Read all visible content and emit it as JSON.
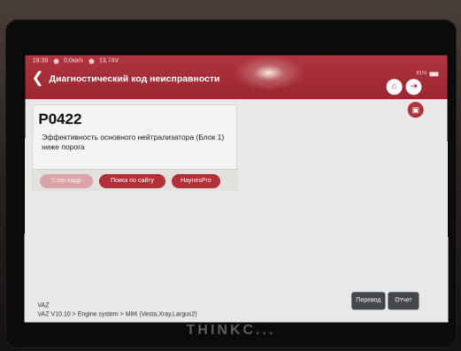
{
  "device": {
    "brand": "THINKC..."
  },
  "status": {
    "time": "19:39",
    "speed": "0,0кв/s",
    "voltage": "13,74V",
    "battery": "91%"
  },
  "header": {
    "title": "Диагностический код неисправности",
    "back_icon": "back-arrow-icon",
    "home_icon": "home-icon",
    "exit_icon": "exit-icon",
    "camera_icon": "camera-icon"
  },
  "dtc": {
    "code": "P0422",
    "description": "Эффективность основного нейтрализатора (Блок 1) ниже порога"
  },
  "actions": {
    "freeze_frame": "Стоп-кадр",
    "web_search": "Поиск по сайту",
    "haynes": "HaynesPro"
  },
  "footer": {
    "make": "VAZ",
    "path": "VAZ V10.10 > Engine system > М86 (Vesta,Xray,Largus2)",
    "translate": "Перевод",
    "report": "Отчет"
  },
  "colors": {
    "accent": "#9a2731",
    "button": "#b3303a",
    "footer_button": "#44474b"
  }
}
